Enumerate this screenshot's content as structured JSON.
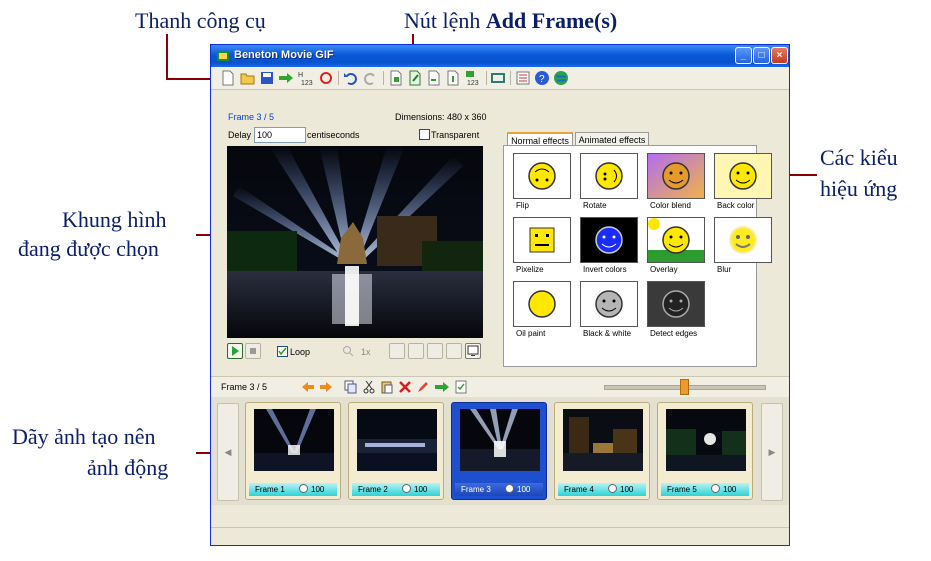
{
  "annotations": {
    "toolbar_label": "Thanh công cụ",
    "add_frame_prefix": "Nút lệnh ",
    "add_frame_bold": "Add Frame(s)",
    "effects_line1": "Các kiểu",
    "effects_line2": "hiệu ứng",
    "selected_line1": "Khung hình",
    "selected_line2": "đang được chọn",
    "sequence_line1": "Dãy ảnh tạo nên",
    "sequence_line2": "ảnh động"
  },
  "window": {
    "title": "Beneton Movie GIF",
    "min_icon": "minimize-icon",
    "max_icon": "maximize-icon",
    "close_icon": "close-icon"
  },
  "toolbar": {
    "icons": [
      "new-icon",
      "open-icon",
      "save-icon",
      "export-arrow-icon",
      "renumber-icon",
      "refresh-icon",
      "undo-icon",
      "redo-icon",
      "add-frame-icon",
      "edit-frame-icon",
      "import-icon",
      "export-icon",
      "sequence-icon",
      "resize-icon",
      "properties-icon",
      "help-icon",
      "web-icon"
    ]
  },
  "frame_info": {
    "frame_label": "Frame 3 / 5",
    "dimensions": "Dimensions: 480 x 360",
    "delay_label": "Delay",
    "delay_value": "100",
    "delay_unit": "centiseconds",
    "transparent_label": "Transparent",
    "transparent_checked": false
  },
  "playback": {
    "loop_label": "Loop",
    "loop_checked": true,
    "zoom": "1x"
  },
  "effects": {
    "tabs": [
      "Normal effects",
      "Animated effects"
    ],
    "active_tab": 0,
    "items": [
      {
        "label": "Flip"
      },
      {
        "label": "Rotate"
      },
      {
        "label": "Color blend"
      },
      {
        "label": "Back color"
      },
      {
        "label": "Pixelize"
      },
      {
        "label": "Invert colors"
      },
      {
        "label": "Overlay"
      },
      {
        "label": "Blur"
      },
      {
        "label": "Oil paint"
      },
      {
        "label": "Black & white"
      },
      {
        "label": "Detect edges"
      }
    ]
  },
  "frame_strip": {
    "counter": "Frame 3 / 5",
    "slider_value": 0.5,
    "selected_index": 2,
    "frames": [
      {
        "label": "Frame 1",
        "delay": "100"
      },
      {
        "label": "Frame 2",
        "delay": "100"
      },
      {
        "label": "Frame 3",
        "delay": "100"
      },
      {
        "label": "Frame 4",
        "delay": "100"
      },
      {
        "label": "Frame 5",
        "delay": "100"
      }
    ]
  },
  "colors": {
    "title_bar": "#0a58d8",
    "annotation_text": "#0a1f6b",
    "leader_line": "#8b0000",
    "selected_frame": "#1d4fcf"
  }
}
